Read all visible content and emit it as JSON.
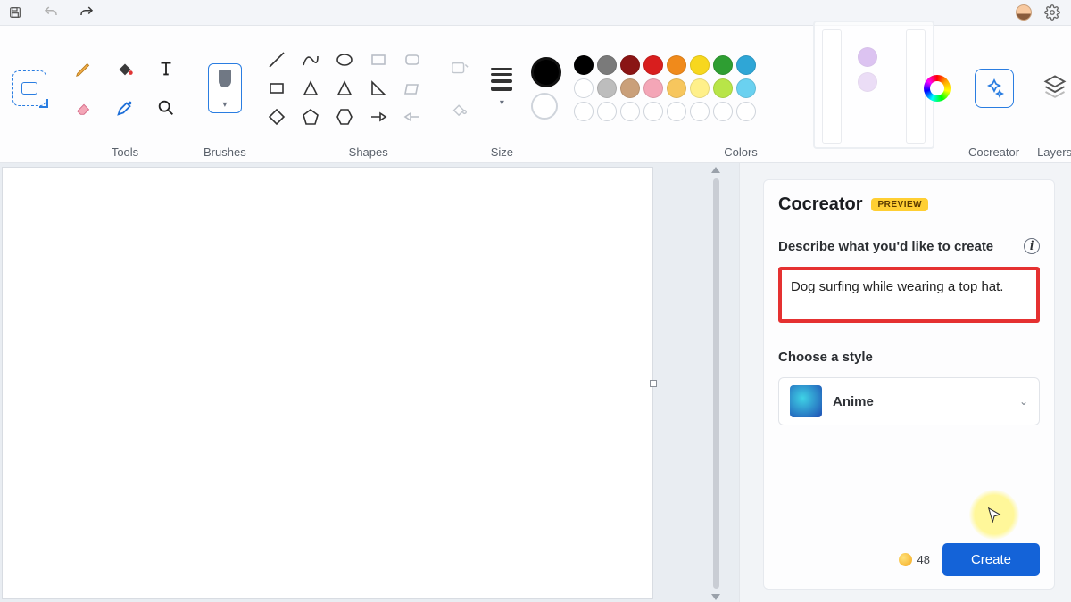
{
  "topbar": {
    "save_icon": "save-icon",
    "undo_icon": "undo-icon",
    "redo_icon": "redo-icon",
    "profile_icon": "profile-avatar",
    "settings_icon": "gear-icon"
  },
  "ribbon": {
    "select_label": "",
    "tools_label": "Tools",
    "brushes_label": "Brushes",
    "shapes_label": "Shapes",
    "size_label": "Size",
    "colors_label": "Colors",
    "cocreator_label": "Cocreator",
    "layers_label": "Layers",
    "tools": [
      "pencil",
      "fill",
      "text",
      "eraser",
      "color-picker",
      "magnifier"
    ],
    "shapes": [
      "line",
      "curve",
      "oval",
      "rectangle",
      "polygon",
      "rounded-rect",
      "triangle",
      "right-triangle",
      "rhombus",
      "diamond",
      "pentagon",
      "hexagon",
      "arrow-right",
      "arrow-left"
    ],
    "palette_row1": [
      "#000000",
      "#7a7a7a",
      "#8a1515",
      "#d81e1e",
      "#f08a1b",
      "#f7d71e",
      "#2e9e32",
      "#2fa6d6",
      "#7b4fd8",
      "#c79ee6"
    ],
    "palette_row2": [
      "#ffffff",
      "#bdbdbd",
      "#caa07a",
      "#f4a6b7",
      "#f7c65d",
      "#fff08a",
      "#b8e548",
      "#6ad1f0",
      "#b39ee6",
      "#d9b9ee"
    ],
    "current_color": "#000000",
    "secondary_color": "#ffffff"
  },
  "cocreator": {
    "title": "Cocreator",
    "badge": "PREVIEW",
    "describe_label": "Describe what you'd like to create",
    "prompt_value": "Dog surfing while wearing a top hat.",
    "style_label": "Choose a style",
    "style_value": "Anime",
    "credits": "48",
    "create_label": "Create"
  }
}
